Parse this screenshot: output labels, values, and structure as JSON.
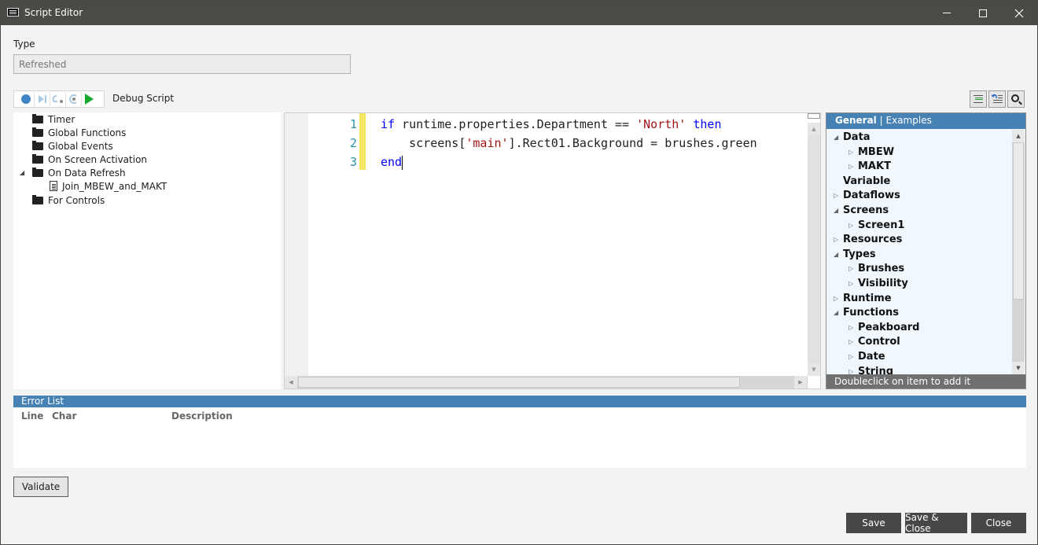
{
  "window": {
    "title": "Script Editor",
    "controls": {
      "minimize": "minimize",
      "maximize": "maximize",
      "close": "close"
    }
  },
  "type_section": {
    "label": "Type",
    "value": "Refreshed"
  },
  "debug_toolbar": {
    "buttons": [
      "record",
      "step-over",
      "step-into",
      "step-out",
      "run"
    ],
    "label": "Debug Script"
  },
  "right_toolbar": {
    "buttons": [
      "format-code",
      "comment-code",
      "search"
    ]
  },
  "script_tree": [
    {
      "label": "Timer",
      "type": "folder",
      "expanded": false
    },
    {
      "label": "Global Functions",
      "type": "folder",
      "expanded": false
    },
    {
      "label": "Global Events",
      "type": "folder",
      "expanded": false
    },
    {
      "label": "On Screen Activation",
      "type": "folder",
      "expanded": false
    },
    {
      "label": "On Data Refresh",
      "type": "folder",
      "expanded": true
    },
    {
      "label": "Join_MBEW_and_MAKT",
      "type": "script",
      "parent": "On Data Refresh"
    },
    {
      "label": "For Controls",
      "type": "folder",
      "expanded": false
    }
  ],
  "editor": {
    "line_numbers": [
      "1",
      "2",
      "3"
    ],
    "lines": [
      [
        {
          "t": "if",
          "c": "kw"
        },
        {
          "t": " runtime.properties.Department == ",
          "c": ""
        },
        {
          "t": "'North'",
          "c": "str"
        },
        {
          "t": " ",
          "c": ""
        },
        {
          "t": "then",
          "c": "kw"
        }
      ],
      [
        {
          "t": "    screens[",
          "c": ""
        },
        {
          "t": "'main'",
          "c": "str"
        },
        {
          "t": "].Rect01.Background = brushes.green",
          "c": ""
        }
      ],
      [
        {
          "t": "end",
          "c": "kw"
        }
      ]
    ]
  },
  "reference_panel": {
    "tabs": {
      "active": "General",
      "separator": "|",
      "inactive": "Examples"
    },
    "items": [
      {
        "label": "Data",
        "level": 0,
        "expander": "expanded"
      },
      {
        "label": "MBEW",
        "level": 1,
        "expander": "collapsed"
      },
      {
        "label": "MAKT",
        "level": 1,
        "expander": "collapsed"
      },
      {
        "label": "Variable",
        "level": 0,
        "expander": "none"
      },
      {
        "label": "Dataflows",
        "level": 0,
        "expander": "collapsed"
      },
      {
        "label": "Screens",
        "level": 0,
        "expander": "expanded"
      },
      {
        "label": "Screen1",
        "level": 1,
        "expander": "collapsed"
      },
      {
        "label": "Resources",
        "level": 0,
        "expander": "collapsed"
      },
      {
        "label": "Types",
        "level": 0,
        "expander": "expanded"
      },
      {
        "label": "Brushes",
        "level": 1,
        "expander": "collapsed"
      },
      {
        "label": "Visibility",
        "level": 1,
        "expander": "collapsed"
      },
      {
        "label": "Runtime",
        "level": 0,
        "expander": "collapsed"
      },
      {
        "label": "Functions",
        "level": 0,
        "expander": "expanded"
      },
      {
        "label": "Peakboard",
        "level": 1,
        "expander": "collapsed"
      },
      {
        "label": "Control",
        "level": 1,
        "expander": "collapsed"
      },
      {
        "label": "Date",
        "level": 1,
        "expander": "collapsed"
      },
      {
        "label": "String",
        "level": 1,
        "expander": "collapsed"
      }
    ],
    "footer": "Doubleclick on item to add it"
  },
  "error_list": {
    "title": "Error List",
    "columns": [
      "Line",
      "Char",
      "Description"
    ],
    "rows": []
  },
  "buttons": {
    "validate": "Validate",
    "save": "Save",
    "save_close": "Save & Close",
    "close": "Close"
  },
  "colors": {
    "titlebar": "#4b4a47",
    "accent_blue": "#4682b4",
    "footer_button": "#474747",
    "keyword": "#0000ff",
    "string": "#a31515",
    "line_number": "#2b91af",
    "change_marker": "#f5e462",
    "run_green": "#17a830"
  }
}
